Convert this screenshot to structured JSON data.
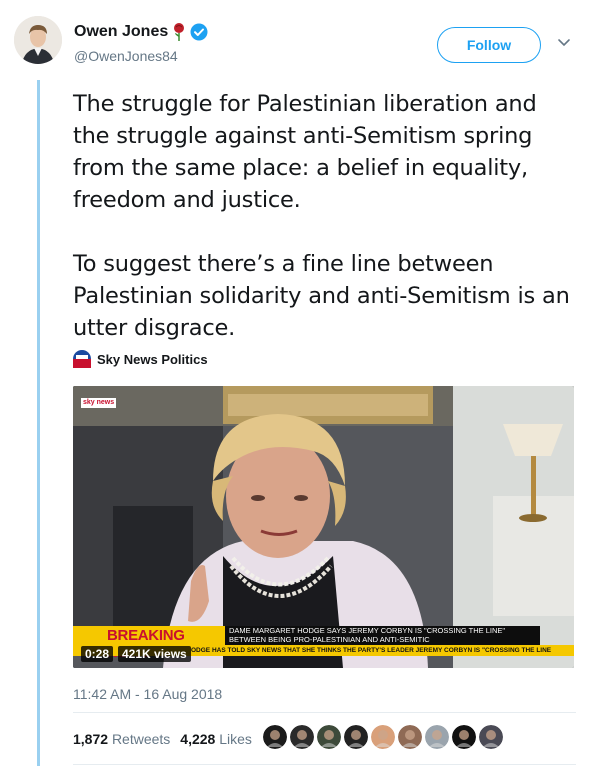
{
  "author": {
    "name": "Owen Jones",
    "handle": "@OwenJones84",
    "emoji_icon": "rose-icon",
    "verified_icon": "verified-badge-icon"
  },
  "follow_label": "Follow",
  "tweet": {
    "paragraphs": [
      "The struggle for Palestinian liberation and the struggle against anti-Semitism spring from the same place: a belief in equality, freedom and justice.",
      "To suggest there’s a fine line between Palestinian solidarity and anti-Semitism is an utter disgrace."
    ]
  },
  "media": {
    "source_name": "Sky News Politics",
    "channel_logo": "sky news",
    "breaking_label": "BREAKING NEWS",
    "headline": "DAME MARGARET HODGE SAYS JEREMY CORBYN IS \"CROSSING THE LINE\" BETWEEN BEING PRO-PALESTINIAN AND ANTI-SEMITIC",
    "ticker": "ODGE HAS TOLD SKY NEWS THAT SHE THINKS THE PARTY'S LEADER JEREMY CORBYN IS \"CROSSING THE LINE",
    "duration": "0:28",
    "views": "421K views"
  },
  "timestamp": "11:42 AM - 16 Aug 2018",
  "stats": {
    "retweets_count": "1,872",
    "retweets_label": "Retweets",
    "likes_count": "4,228",
    "likes_label": "Likes"
  },
  "colors": {
    "accent": "#1da1f2",
    "thread_line": "#9ad0f0",
    "breaking_yellow": "#f5c800",
    "breaking_red": "#c8102e",
    "muted_text": "#657786"
  },
  "liker_avatars": [
    "#1b1b1b",
    "#2a2a2a",
    "#3d4a3a",
    "#222222",
    "#d9a07a",
    "#8f6a55",
    "#9aa4ad",
    "#111111",
    "#4a4a55"
  ]
}
